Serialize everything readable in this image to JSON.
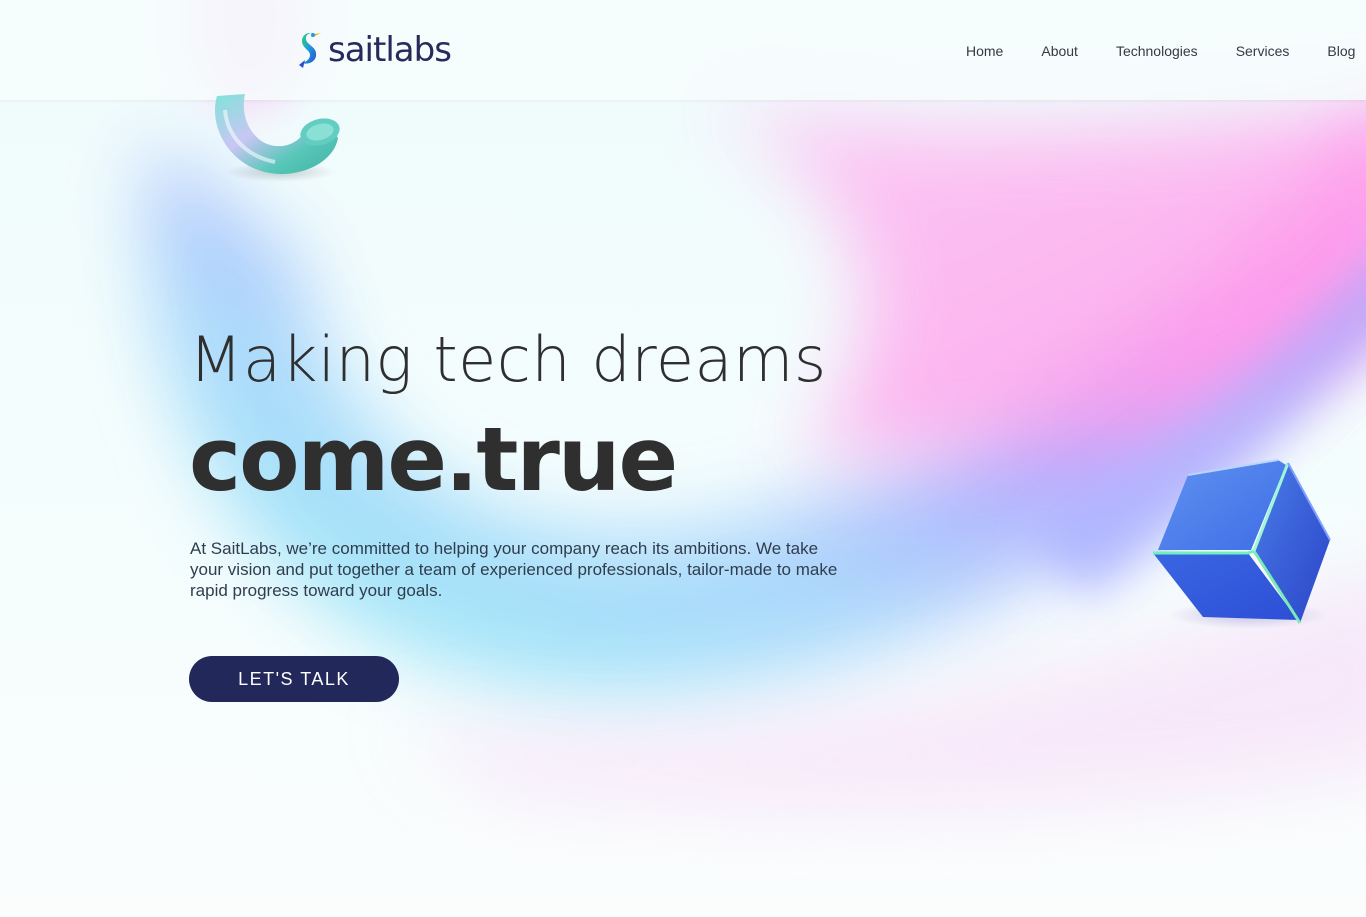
{
  "brand": {
    "name": "saitlabs",
    "colors": {
      "primary": "#22285a",
      "text": "#2f2f2f",
      "accent_pink": "#ff88e8",
      "accent_cyan": "#9ef2f6",
      "accent_blue": "#8fa6ff"
    }
  },
  "nav": {
    "items": [
      {
        "label": "Home"
      },
      {
        "label": "About"
      },
      {
        "label": "Technologies"
      },
      {
        "label": "Services"
      },
      {
        "label": "Blog"
      }
    ]
  },
  "hero": {
    "line1": "Making tech dreams",
    "line2": "come.true",
    "description": "At SaitLabs, we’re committed to helping your company reach its ambitions. We take your vision and put together a team of experienced professionals, tailor-made to make rapid progress toward your goals.",
    "cta_label": "LET'S TALK"
  },
  "decor": {
    "ring_icon": "3d-ring-icon",
    "cube_icon": "3d-cube-icon",
    "logo_icon": "heron-logo-icon"
  }
}
